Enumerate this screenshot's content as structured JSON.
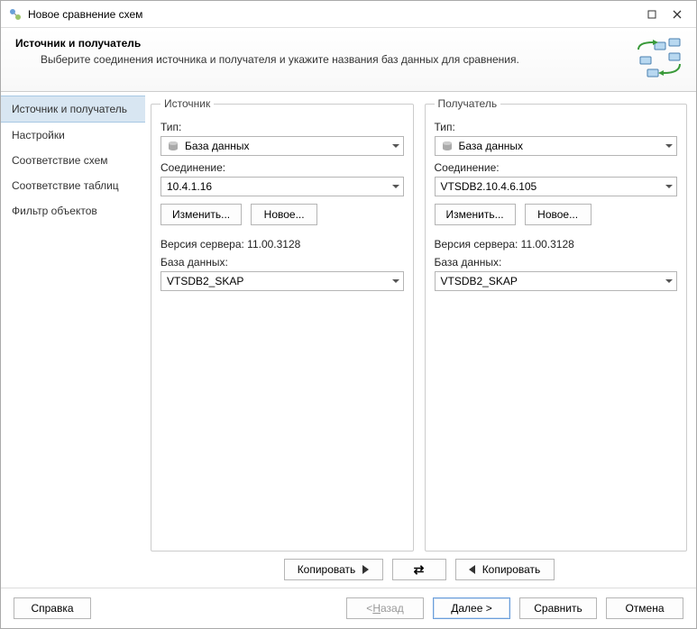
{
  "window": {
    "title": "Новое сравнение схем"
  },
  "banner": {
    "title": "Источник и получатель",
    "subtitle": "Выберите соединения источника и получателя и укажите названия баз данных для сравнения."
  },
  "sidebar": {
    "items": [
      {
        "label": "Источник и получатель",
        "selected": true
      },
      {
        "label": "Настройки",
        "selected": false
      },
      {
        "label": "Соответствие схем",
        "selected": false
      },
      {
        "label": "Соответствие таблиц",
        "selected": false
      },
      {
        "label": "Фильтр объектов",
        "selected": false
      }
    ]
  },
  "source": {
    "legend": "Источник",
    "type_label": "Тип:",
    "type_value": "База данных",
    "conn_label": "Соединение:",
    "conn_value": "10.4.1.16",
    "edit_btn": "Изменить...",
    "new_btn": "Новое...",
    "version_label": "Версия сервера: 11.00.3128",
    "db_label": "База данных:",
    "db_value": "VTSDB2_SKAP"
  },
  "target": {
    "legend": "Получатель",
    "type_label": "Тип:",
    "type_value": "База данных",
    "conn_label": "Соединение:",
    "conn_value": "VTSDB2.10.4.6.105",
    "edit_btn": "Изменить...",
    "new_btn": "Новое...",
    "version_label": "Версия сервера: 11.00.3128",
    "db_label": "База данных:",
    "db_value": "VTSDB2_SKAP"
  },
  "copy": {
    "copy_right": "Копировать",
    "copy_left": "Копировать"
  },
  "footer": {
    "help": "Справка",
    "back_prefix": "< ",
    "back_u": "Н",
    "back_rest": "азад",
    "next_u": "Д",
    "next_rest": "алее >",
    "compare": "Сравнить",
    "cancel": "Отмена"
  }
}
